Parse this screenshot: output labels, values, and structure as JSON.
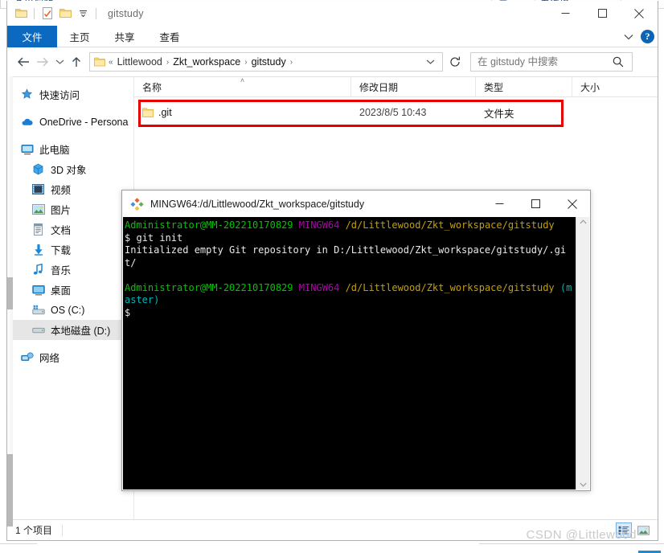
{
  "window": {
    "title": "gitstudy",
    "minimize_label": "─",
    "maximize_label": "□",
    "close_label": "✕",
    "quick_access": [
      {
        "name": "folder-icon"
      },
      {
        "name": "properties-icon"
      },
      {
        "name": "new-folder-icon"
      },
      {
        "name": "customize-qat-icon",
        "label": "▾"
      }
    ]
  },
  "ribbon": {
    "tabs": [
      {
        "label": "文件",
        "id": "file",
        "active": true
      },
      {
        "label": "主页",
        "id": "home",
        "active": false
      },
      {
        "label": "共享",
        "id": "share",
        "active": false
      },
      {
        "label": "查看",
        "id": "view",
        "active": false
      }
    ],
    "collapse_label": "∨",
    "help_label": "?"
  },
  "nav": {
    "back_label": "←",
    "forward_label": "→",
    "recent_label": "∨",
    "up_label": "↑",
    "refresh_label": "↻",
    "address_prefix": "«",
    "breadcrumbs": [
      "Littlewood",
      "Zkt_workspace",
      "gitstudy"
    ],
    "breadcrumb_sep": "›",
    "address_chevron": "∨"
  },
  "search": {
    "placeholder": "在 gitstudy 中搜索",
    "value": "",
    "icon_label": "⌕"
  },
  "sidebar": {
    "items": [
      {
        "label": "快速访问",
        "icon": "pin-star-icon",
        "indent": false,
        "selected": false
      },
      {
        "label": "OneDrive - Persona",
        "icon": "onedrive-cloud-icon",
        "indent": false,
        "selected": false
      },
      {
        "label": "此电脑",
        "icon": "this-pc-monitor-icon",
        "indent": false,
        "selected": false
      },
      {
        "label": "3D 对象",
        "icon": "3d-objects-icon",
        "indent": true,
        "selected": false
      },
      {
        "label": "视频",
        "icon": "videos-icon",
        "indent": true,
        "selected": false
      },
      {
        "label": "图片",
        "icon": "pictures-icon",
        "indent": true,
        "selected": false
      },
      {
        "label": "文档",
        "icon": "documents-icon",
        "indent": true,
        "selected": false
      },
      {
        "label": "下载",
        "icon": "downloads-icon",
        "indent": true,
        "selected": false
      },
      {
        "label": "音乐",
        "icon": "music-icon",
        "indent": true,
        "selected": false
      },
      {
        "label": "桌面",
        "icon": "desktop-icon",
        "indent": true,
        "selected": false
      },
      {
        "label": "OS (C:)",
        "icon": "drive-os-icon",
        "indent": true,
        "selected": false
      },
      {
        "label": "本地磁盘 (D:)",
        "icon": "drive-local-d-icon",
        "indent": true,
        "selected": true
      },
      {
        "label": "网络",
        "icon": "network-icon",
        "indent": false,
        "selected": false
      }
    ]
  },
  "file_list": {
    "columns": [
      {
        "label": "名称",
        "sorted": true,
        "sort_mark": "˄"
      },
      {
        "label": "修改日期",
        "sorted": false,
        "sort_mark": ""
      },
      {
        "label": "类型",
        "sorted": false,
        "sort_mark": ""
      },
      {
        "label": "大小",
        "sorted": false,
        "sort_mark": ""
      }
    ],
    "rows": [
      {
        "name": ".git",
        "date": "2023/8/5 10:43",
        "type": "文件夹",
        "size": "",
        "icon": "folder-icon",
        "highlighted": true
      }
    ],
    "highlight_color": "#e60000"
  },
  "status": {
    "item_count": "1 个项目",
    "view_details_icon": "details-view-icon",
    "view_large_icons_icon": "large-icons-view-icon"
  },
  "terminal": {
    "title": "MINGW64:/d/Littlewood/Zkt_workspace/gitstudy",
    "minimize_label": "─",
    "maximize_label": "□",
    "close_label": "✕",
    "scroll_up_label": "∧",
    "scroll_down_label": "∨",
    "colors": {
      "user": "#00c400",
      "host": "#b300b3",
      "path": "#c4a000",
      "branch": "#00b3b3",
      "text": "#e8e8e8",
      "background": "#000000"
    },
    "lines": [
      {
        "segments": [
          {
            "text": "Administrator@MM-202210170829",
            "class": "t-user"
          },
          {
            "text": " ",
            "class": "t-plain"
          },
          {
            "text": "MINGW64",
            "class": "t-host"
          },
          {
            "text": " ",
            "class": "t-plain"
          },
          {
            "text": "/d/Littlewood/Zkt_workspace/gitstudy",
            "class": "t-path"
          }
        ]
      },
      {
        "segments": [
          {
            "text": "$ git init",
            "class": "t-plain"
          }
        ]
      },
      {
        "segments": [
          {
            "text": "Initialized empty Git repository in D:/Littlewood/Zkt_workspace/gitstudy/.git/",
            "class": "t-plain"
          }
        ]
      },
      {
        "segments": [
          {
            "text": "",
            "class": "t-plain"
          }
        ]
      },
      {
        "segments": [
          {
            "text": "Administrator@MM-202210170829",
            "class": "t-user"
          },
          {
            "text": " ",
            "class": "t-plain"
          },
          {
            "text": "MINGW64",
            "class": "t-host"
          },
          {
            "text": " ",
            "class": "t-plain"
          },
          {
            "text": "/d/Littlewood/Zkt_workspace/gitstudy",
            "class": "t-path"
          },
          {
            "text": " ",
            "class": "t-plain"
          },
          {
            "text": "(master)",
            "class": "t-branch"
          }
        ]
      },
      {
        "segments": [
          {
            "text": "$",
            "class": "t-plain"
          }
        ]
      }
    ]
  },
  "watermark": {
    "text": "CSDN @Littlewood"
  },
  "background_window": {
    "ghost_text_left": "色出调整",
    "ghost_text_mid": "元",
    "ghost_text_right": "者选择…"
  }
}
